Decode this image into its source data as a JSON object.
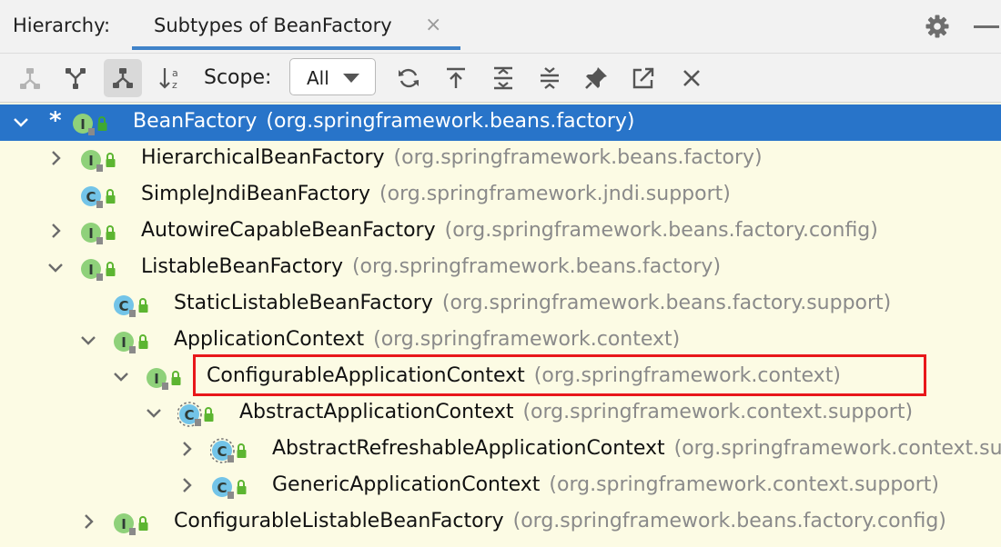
{
  "header": {
    "title": "Hierarchy:",
    "tab_label": "Subtypes of BeanFactory",
    "tab_close_glyph": "×"
  },
  "toolbar": {
    "buttons": [
      {
        "name": "supertypes-hierarchy-icon",
        "active": false
      },
      {
        "name": "subtypes-hierarchy-icon",
        "active": false
      },
      {
        "name": "class-hierarchy-icon",
        "active": true
      },
      {
        "name": "sort-alphabetically-icon",
        "active": false
      }
    ],
    "scope_label": "Scope:",
    "scope_value": "All",
    "actions": [
      "refresh-icon",
      "export-icon",
      "expand-all-icon",
      "collapse-all-icon",
      "pin-icon",
      "open-in-window-icon",
      "close-icon"
    ]
  },
  "tree": {
    "rows": [
      {
        "kind": "I",
        "name": "BeanFactory",
        "pkg": "(org.springframework.beans.factory)",
        "expanded": true,
        "selected": true,
        "star": "*",
        "abstract": false
      },
      {
        "kind": "I",
        "name": "HierarchicalBeanFactory",
        "pkg": "(org.springframework.beans.factory)",
        "expanded": false,
        "abstract": false
      },
      {
        "kind": "C",
        "name": "SimpleJndiBeanFactory",
        "pkg": "(org.springframework.jndi.support)",
        "expanded": null,
        "abstract": false
      },
      {
        "kind": "I",
        "name": "AutowireCapableBeanFactory",
        "pkg": "(org.springframework.beans.factory.config)",
        "expanded": false,
        "abstract": false
      },
      {
        "kind": "I",
        "name": "ListableBeanFactory",
        "pkg": "(org.springframework.beans.factory)",
        "expanded": true,
        "abstract": false
      },
      {
        "kind": "C",
        "name": "StaticListableBeanFactory",
        "pkg": "(org.springframework.beans.factory.support)",
        "expanded": null,
        "abstract": false
      },
      {
        "kind": "I",
        "name": "ApplicationContext",
        "pkg": "(org.springframework.context)",
        "expanded": true,
        "abstract": false
      },
      {
        "kind": "I",
        "name": "ConfigurableApplicationContext",
        "pkg": "(org.springframework.context)",
        "expanded": true,
        "abstract": false,
        "highlighted": true
      },
      {
        "kind": "C",
        "name": "AbstractApplicationContext",
        "pkg": "(org.springframework.context.support)",
        "expanded": true,
        "abstract": true
      },
      {
        "kind": "C",
        "name": "AbstractRefreshableApplicationContext",
        "pkg": "(org.springframework.context.support)",
        "expanded": false,
        "abstract": true
      },
      {
        "kind": "C",
        "name": "GenericApplicationContext",
        "pkg": "(org.springframework.context.support)",
        "expanded": false,
        "abstract": false
      },
      {
        "kind": "I",
        "name": "ConfigurableListableBeanFactory",
        "pkg": "(org.springframework.beans.factory.config)",
        "expanded": false,
        "abstract": false
      }
    ]
  },
  "colors": {
    "selection": "#2874c9",
    "interface_badge": "#8fd17a",
    "class_badge": "#73c4e8",
    "lock": "#5cb531",
    "highlight_border": "#e8171a",
    "tree_background": "#fcfbe4"
  }
}
